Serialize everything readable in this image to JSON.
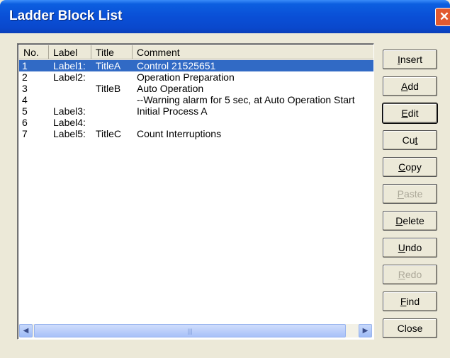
{
  "window": {
    "title": "Ladder Block List",
    "close_glyph": "✕"
  },
  "columns": [
    "No.",
    "Label",
    "Title",
    "Comment"
  ],
  "rows": [
    {
      "no": "1",
      "label": "Label1:",
      "title": "TitleA",
      "comment": "Control 21525651",
      "selected": true
    },
    {
      "no": "2",
      "label": "Label2:",
      "title": "",
      "comment": "Operation Preparation",
      "selected": false
    },
    {
      "no": "3",
      "label": "",
      "title": "TitleB",
      "comment": "Auto Operation",
      "selected": false
    },
    {
      "no": "4",
      "label": "",
      "title": "",
      "comment": "--Warning alarm for 5 sec, at Auto Operation Start",
      "selected": false
    },
    {
      "no": "5",
      "label": "Label3:",
      "title": "",
      "comment": "Initial Process A",
      "selected": false
    },
    {
      "no": "6",
      "label": "Label4:",
      "title": "",
      "comment": "",
      "selected": false
    },
    {
      "no": "7",
      "label": "Label5:",
      "title": "TitleC",
      "comment": "Count Interruptions",
      "selected": false
    }
  ],
  "buttons": [
    {
      "name": "insert-button",
      "label": "Insert",
      "accel_index": 0,
      "enabled": true
    },
    {
      "name": "add-button",
      "label": "Add",
      "accel_index": 0,
      "enabled": true
    },
    {
      "name": "edit-button",
      "label": "Edit",
      "accel_index": 0,
      "enabled": true,
      "focused": true
    },
    {
      "name": "cut-button",
      "label": "Cut",
      "accel_index": 2,
      "enabled": true
    },
    {
      "name": "copy-button",
      "label": "Copy",
      "accel_index": 0,
      "enabled": true
    },
    {
      "name": "paste-button",
      "label": "Paste",
      "accel_index": 0,
      "enabled": false
    },
    {
      "name": "delete-button",
      "label": "Delete",
      "accel_index": 0,
      "enabled": true
    },
    {
      "name": "undo-button",
      "label": "Undo",
      "accel_index": 0,
      "enabled": true
    },
    {
      "name": "redo-button",
      "label": "Redo",
      "accel_index": 0,
      "enabled": false
    },
    {
      "name": "find-button",
      "label": "Find",
      "accel_index": 0,
      "enabled": true
    },
    {
      "name": "close-button",
      "label": "Close",
      "accel_index": -1,
      "enabled": true
    }
  ],
  "scrollbar": {
    "left_glyph": "◀",
    "right_glyph": "▶",
    "grip_glyph": "|||"
  },
  "colors": {
    "title_bar": "#0A4FD6",
    "selection": "#316AC5",
    "dialog_bg": "#ECE9D8",
    "close": "#E25A30"
  }
}
